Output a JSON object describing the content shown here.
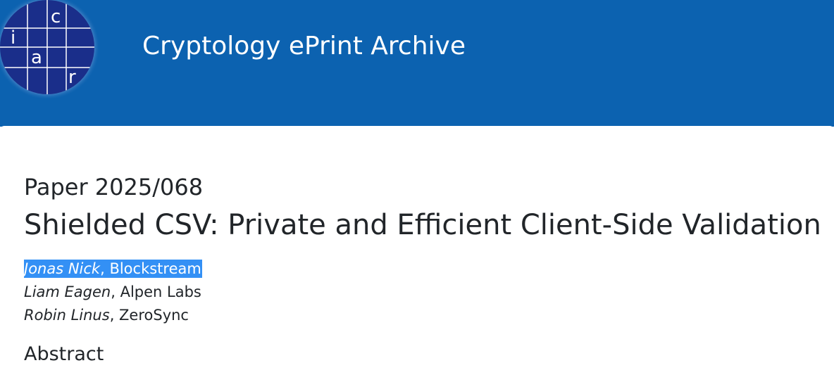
{
  "header": {
    "site_title": "Cryptology ePrint Archive",
    "logo": {
      "letters": [
        "c",
        "i",
        "a",
        "r"
      ]
    },
    "background_color": "#0c62b0"
  },
  "paper": {
    "id_label": "Paper 2025/068",
    "title": "Shielded CSV: Private and Efficient Client-Side Validation",
    "authors": [
      {
        "name": "Jonas Nick",
        "affiliation": ", Blockstream",
        "selected": true
      },
      {
        "name": "Liam Eagen",
        "affiliation": ", Alpen Labs",
        "selected": false
      },
      {
        "name": "Robin Linus",
        "affiliation": ", ZeroSync",
        "selected": false
      }
    ],
    "abstract_heading": "Abstract"
  },
  "colors": {
    "selection_highlight": "#3390f5",
    "logo_circle": "#1a2e8a",
    "text": "#212529"
  }
}
